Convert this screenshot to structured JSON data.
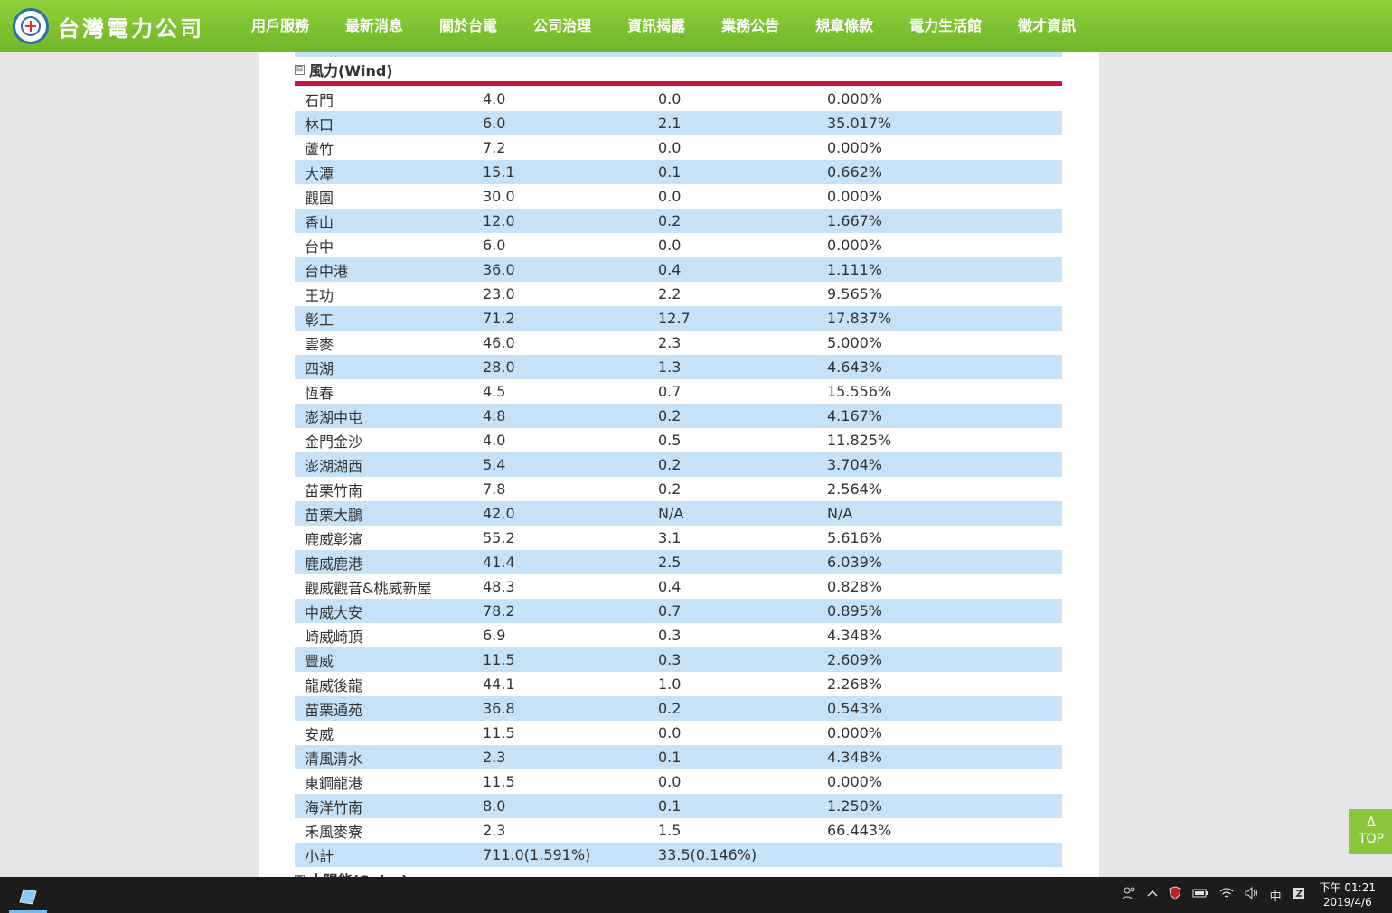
{
  "header": {
    "logo_text": "台灣電力公司",
    "nav": [
      "用戶服務",
      "最新消息",
      "關於台電",
      "公司治理",
      "資訊揭露",
      "業務公告",
      "規章條款",
      "電力生活館",
      "徵才資訊"
    ],
    "active_index": 4
  },
  "section": {
    "toggle": "⊟",
    "title": "風力(Wind)"
  },
  "rows": [
    [
      "石門",
      "4.0",
      "0.0",
      "0.000%"
    ],
    [
      "林口",
      "6.0",
      "2.1",
      "35.017%"
    ],
    [
      "蘆竹",
      "7.2",
      "0.0",
      "0.000%"
    ],
    [
      "大潭",
      "15.1",
      "0.1",
      "0.662%"
    ],
    [
      "觀園",
      "30.0",
      "0.0",
      "0.000%"
    ],
    [
      "香山",
      "12.0",
      "0.2",
      "1.667%"
    ],
    [
      "台中",
      "6.0",
      "0.0",
      "0.000%"
    ],
    [
      "台中港",
      "36.0",
      "0.4",
      "1.111%"
    ],
    [
      "王功",
      "23.0",
      "2.2",
      "9.565%"
    ],
    [
      "彰工",
      "71.2",
      "12.7",
      "17.837%"
    ],
    [
      "雲麥",
      "46.0",
      "2.3",
      "5.000%"
    ],
    [
      "四湖",
      "28.0",
      "1.3",
      "4.643%"
    ],
    [
      "恆春",
      "4.5",
      "0.7",
      "15.556%"
    ],
    [
      "澎湖中屯",
      "4.8",
      "0.2",
      "4.167%"
    ],
    [
      "金門金沙",
      "4.0",
      "0.5",
      "11.825%"
    ],
    [
      "澎湖湖西",
      "5.4",
      "0.2",
      "3.704%"
    ],
    [
      "苗栗竹南",
      "7.8",
      "0.2",
      "2.564%"
    ],
    [
      "苗栗大鵬",
      "42.0",
      "N/A",
      "N/A"
    ],
    [
      "鹿威彰濱",
      "55.2",
      "3.1",
      "5.616%"
    ],
    [
      "鹿威鹿港",
      "41.4",
      "2.5",
      "6.039%"
    ],
    [
      "觀威觀音&桃威新屋",
      "48.3",
      "0.4",
      "0.828%"
    ],
    [
      "中威大安",
      "78.2",
      "0.7",
      "0.895%"
    ],
    [
      "崎威崎頂",
      "6.9",
      "0.3",
      "4.348%"
    ],
    [
      "豐威",
      "11.5",
      "0.3",
      "2.609%"
    ],
    [
      "龍威後龍",
      "44.1",
      "1.0",
      "2.268%"
    ],
    [
      "苗栗通苑",
      "36.8",
      "0.2",
      "0.543%"
    ],
    [
      "安威",
      "11.5",
      "0.0",
      "0.000%"
    ],
    [
      "清風清水",
      "2.3",
      "0.1",
      "4.348%"
    ],
    [
      "東鋼龍港",
      "11.5",
      "0.0",
      "0.000%"
    ],
    [
      "海洋竹南",
      "8.0",
      "0.1",
      "1.250%"
    ],
    [
      "禾風麥寮",
      "2.3",
      "1.5",
      "66.443%"
    ],
    [
      "小計",
      "711.0(1.591%)",
      "33.5(0.146%)",
      ""
    ]
  ],
  "next_section": {
    "toggle": "⊟",
    "title": "太陽能(Solar)"
  },
  "top_button": {
    "arrow": "Δ",
    "label": "TOP"
  },
  "taskbar": {
    "ime": "中",
    "time": "下午 01:21",
    "date": "2019/4/6"
  }
}
